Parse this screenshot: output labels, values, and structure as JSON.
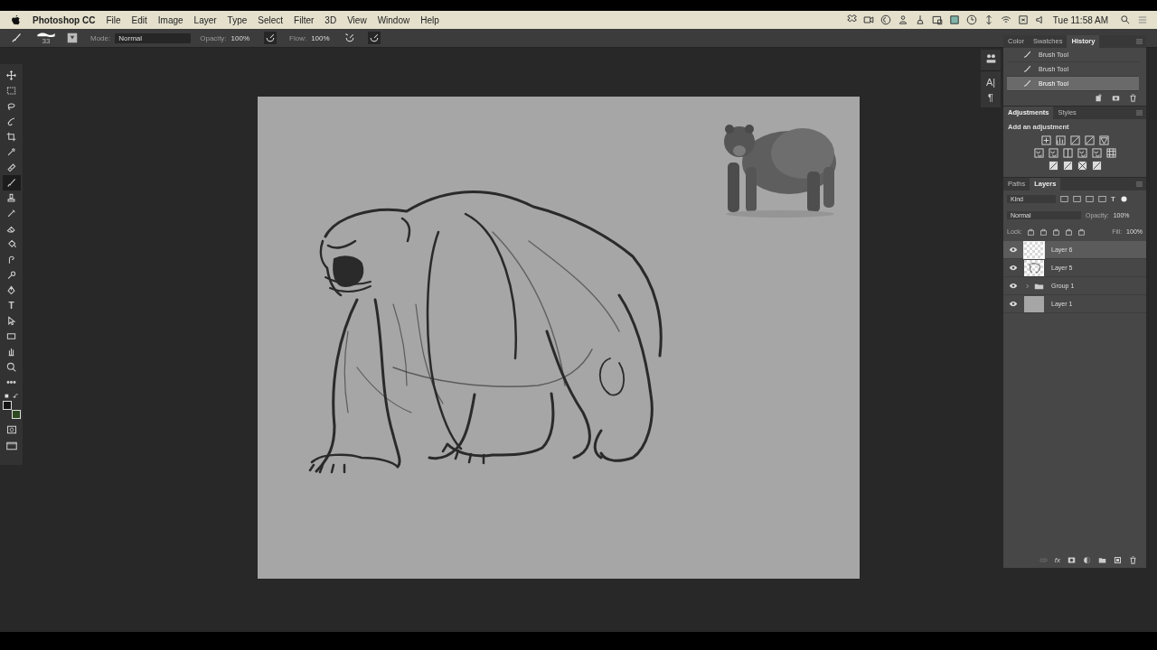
{
  "menu_bar": {
    "app_name": "Photoshop CC",
    "items": [
      "File",
      "Edit",
      "Image",
      "Layer",
      "Type",
      "Select",
      "Filter",
      "3D",
      "View",
      "Window",
      "Help"
    ],
    "clock": "Tue 11:58 AM"
  },
  "options_bar": {
    "brush_size": "33",
    "mode_label": "Mode:",
    "mode": "Normal",
    "opacity_label": "Opacity:",
    "opacity": "100%",
    "flow_label": "Flow:",
    "flow": "100%"
  },
  "tools": [
    {
      "kind": "move",
      "selected": false
    },
    {
      "kind": "marquee",
      "selected": false
    },
    {
      "kind": "lasso",
      "selected": false
    },
    {
      "kind": "quick-select",
      "selected": false
    },
    {
      "kind": "crop",
      "selected": false
    },
    {
      "kind": "eyedropper",
      "selected": false
    },
    {
      "kind": "healing",
      "selected": false
    },
    {
      "kind": "brush",
      "selected": true
    },
    {
      "kind": "stamp",
      "selected": false
    },
    {
      "kind": "history-brush",
      "selected": false
    },
    {
      "kind": "eraser",
      "selected": false
    },
    {
      "kind": "bucket",
      "selected": false
    },
    {
      "kind": "smudge",
      "selected": false
    },
    {
      "kind": "dodge",
      "selected": false
    },
    {
      "kind": "pen",
      "selected": false
    },
    {
      "kind": "type",
      "selected": false,
      "glyph": "T"
    },
    {
      "kind": "path-select",
      "selected": false
    },
    {
      "kind": "rectangle",
      "selected": false
    },
    {
      "kind": "hand",
      "selected": false
    },
    {
      "kind": "zoom",
      "selected": false
    },
    {
      "kind": "more",
      "selected": false,
      "glyph": "•••"
    }
  ],
  "color_swatches": [
    {
      "kind": "foreground",
      "color": "#141414"
    },
    {
      "kind": "background",
      "color": "#2d4a20"
    }
  ],
  "dock": {
    "type_glyph": "A|",
    "paragraph_glyph": "¶"
  },
  "history_panel": {
    "tabs": [
      {
        "label": "Color",
        "selected": false
      },
      {
        "label": "Swatches",
        "selected": false
      },
      {
        "label": "History",
        "selected": true
      }
    ],
    "items": [
      {
        "label": "Brush Tool",
        "selected": false
      },
      {
        "label": "Brush Tool",
        "selected": false
      },
      {
        "label": "Brush Tool",
        "selected": true
      }
    ]
  },
  "adjustments_panel": {
    "tabs": [
      {
        "label": "Adjustments",
        "selected": true
      },
      {
        "label": "Styles",
        "selected": false
      }
    ],
    "hint": "Add an adjustment"
  },
  "layers_panel": {
    "tabs": [
      {
        "label": "Paths",
        "selected": false
      },
      {
        "label": "Layers",
        "selected": true
      }
    ],
    "filter": "Kind",
    "type_filter_glyph": "T",
    "blend_mode": "Normal",
    "opacity_label": "Opacity:",
    "opacity": "100%",
    "lock_label": "Lock:",
    "fill_label": "Fill:",
    "fill": "100%",
    "fx_label": "fx",
    "layers": [
      {
        "name": "Layer 6",
        "kind": "empty",
        "visible": true,
        "selected": true
      },
      {
        "name": "Layer 5",
        "kind": "sketch",
        "visible": true,
        "selected": false
      },
      {
        "name": "Group 1",
        "kind": "group",
        "visible": true,
        "selected": false
      },
      {
        "name": "Layer 1",
        "kind": "fill",
        "visible": true,
        "selected": false
      }
    ]
  }
}
